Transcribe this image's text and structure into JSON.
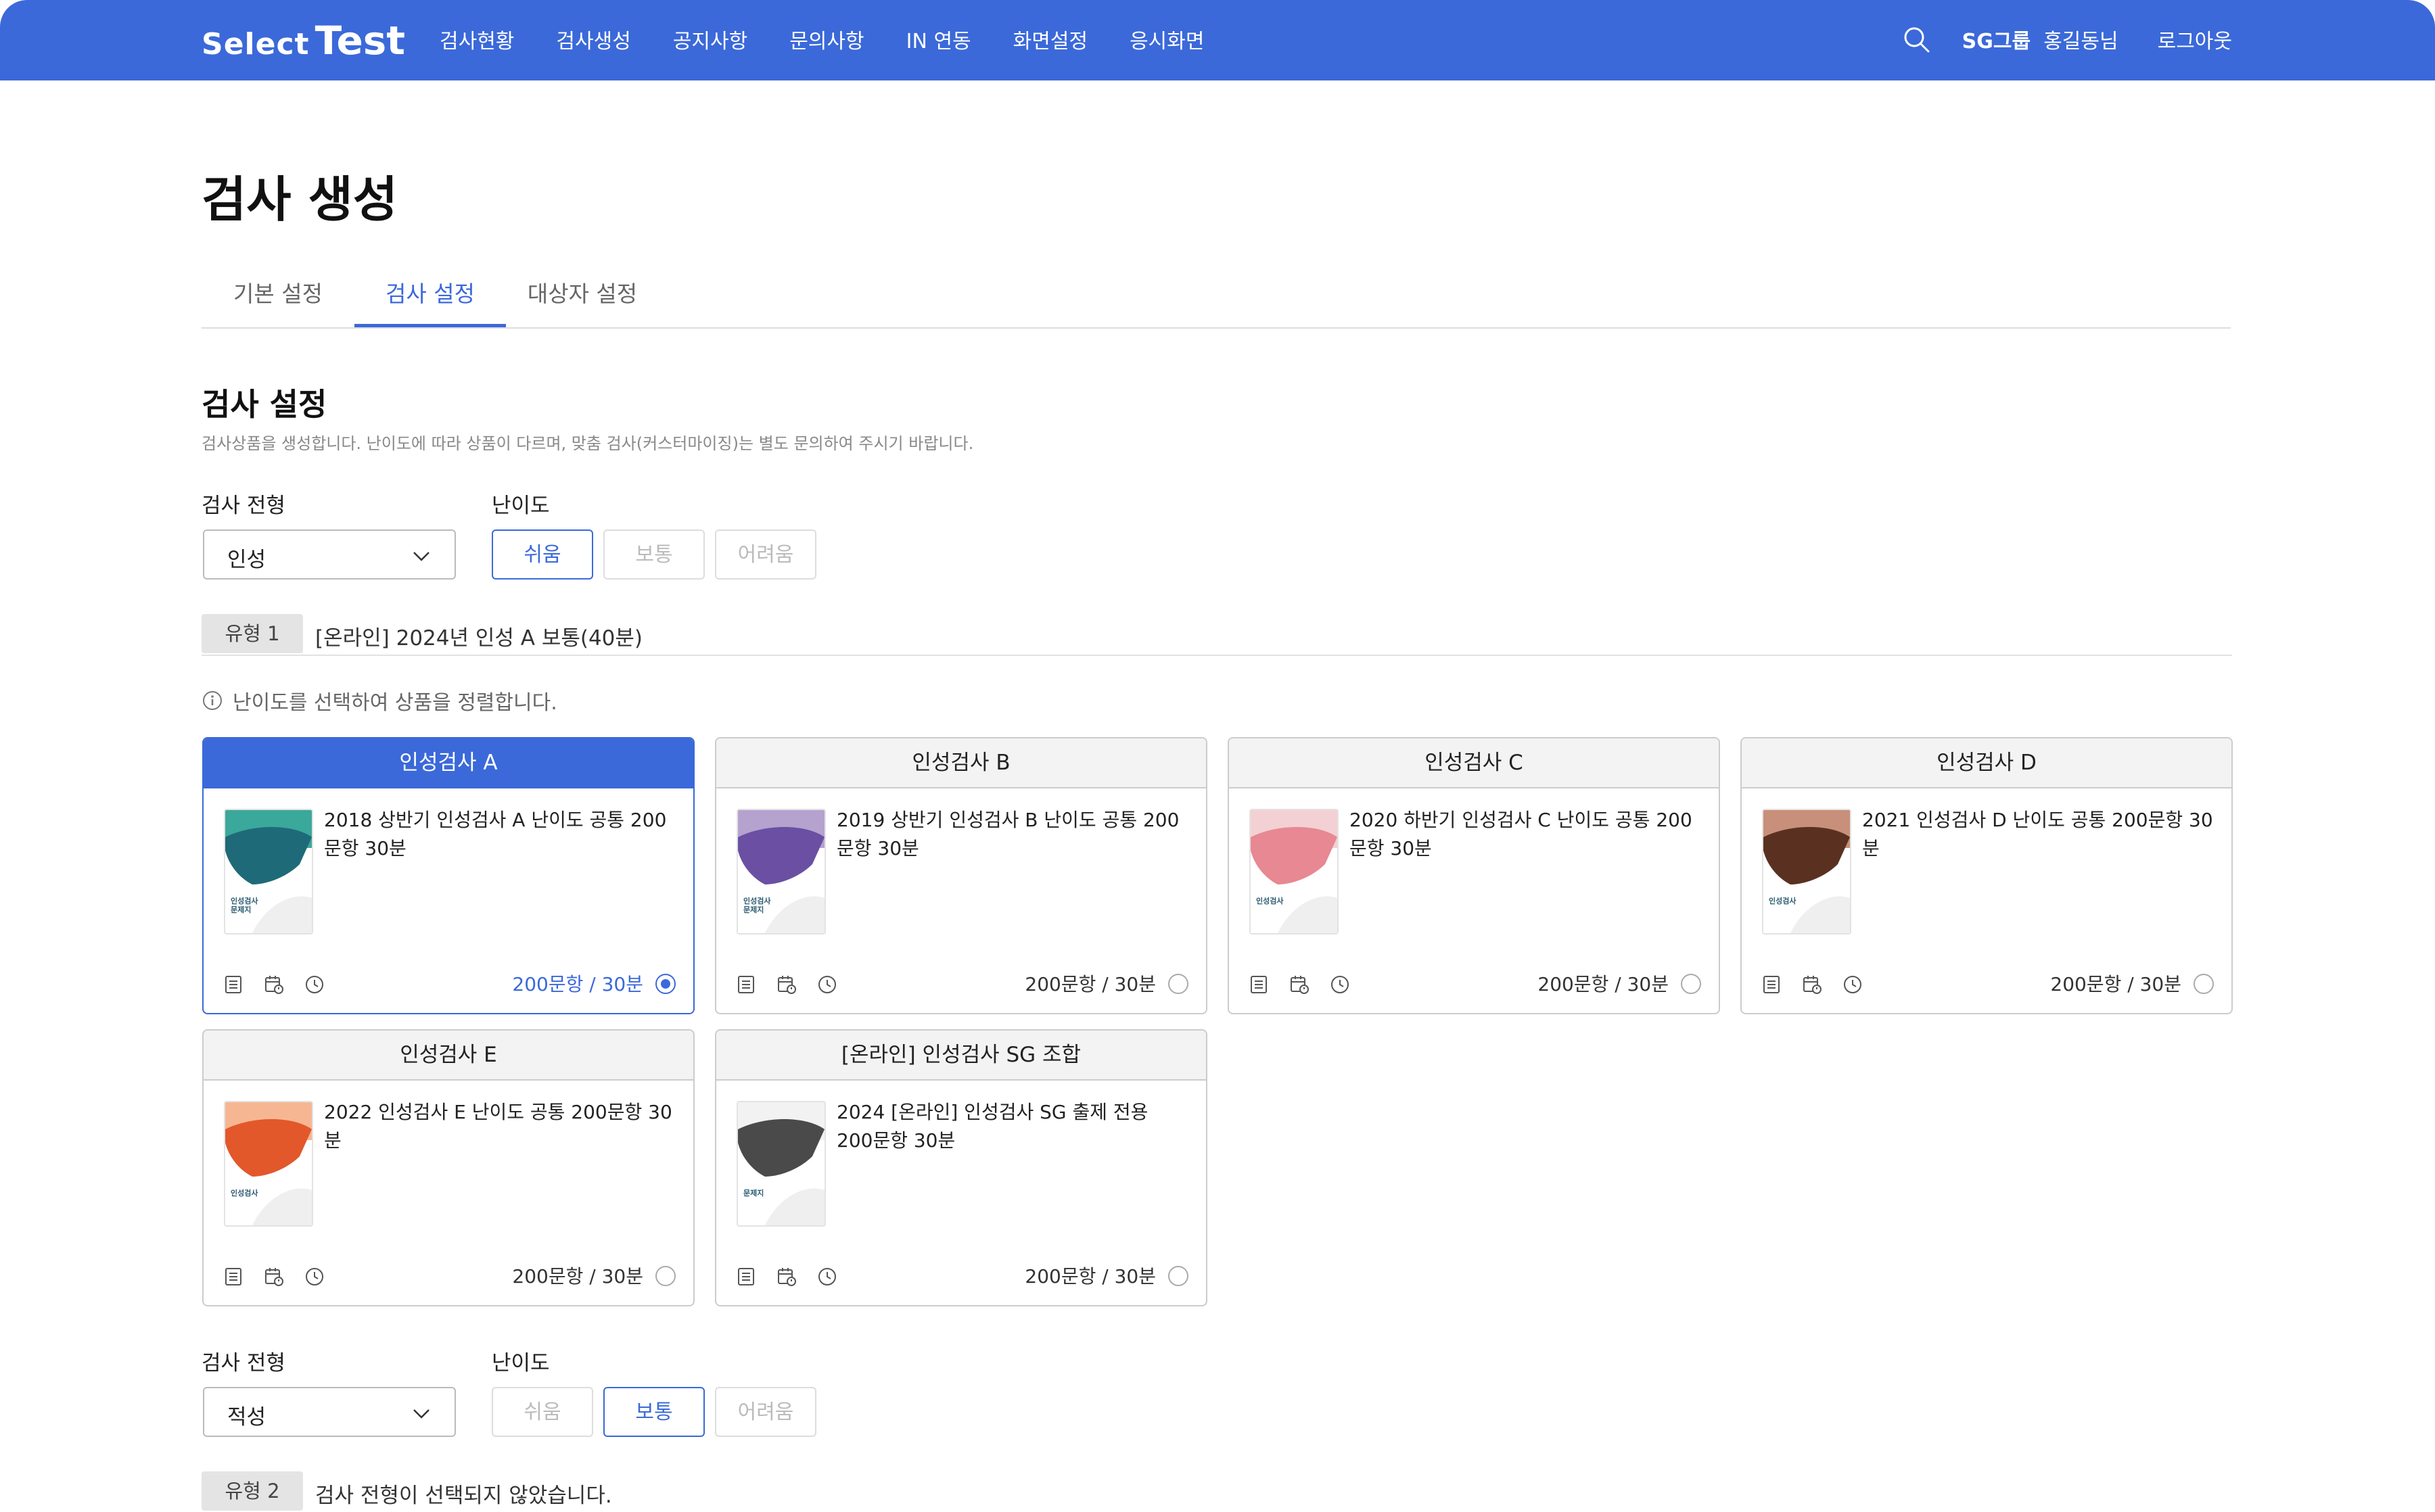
{
  "header": {
    "logo_part1": "Select",
    "logo_part2": "Test",
    "nav": [
      "검사현황",
      "검사생성",
      "공지사항",
      "문의사항",
      "IN 연동",
      "화면설정",
      "응시화면"
    ],
    "user_group": "SG그룹",
    "user_name": "홍길동님",
    "logout": "로그아웃",
    "search_icon": "search-icon"
  },
  "page": {
    "title": "검사 생성",
    "tabs": [
      {
        "label": "기본 설정",
        "active": false
      },
      {
        "label": "검사 설정",
        "active": true
      },
      {
        "label": "대상자 설정",
        "active": false
      }
    ]
  },
  "section": {
    "title": "검사 설정",
    "description": "검사상품을 생성합니다. 난이도에 따라 상품이 다르며, 맞춤 검사(커스터마이징)는 별도 문의하여 주시기 바랍니다."
  },
  "labels": {
    "exam_type": "검사 전형",
    "difficulty": "난이도"
  },
  "difficulty_options": [
    "쉬움",
    "보통",
    "어려움"
  ],
  "block1": {
    "type_value": "인성",
    "selected_difficulty": "쉬움",
    "type_badge": "유형 1",
    "type_text": "[온라인] 2024년 인성 A 보통(40분)",
    "info_text": "난이도를 선택하여 상품을 정렬합니다.",
    "cards": [
      {
        "title": "인성검사 A",
        "description": "2018 상반기 인성검사 A 난이도 공통 200문항 30분",
        "meta": "200문항 / 30분",
        "selected": true,
        "cover_top": "#3aa89a",
        "cover_shape": "#1f6a78",
        "cover_label": "인성검사\n문제지"
      },
      {
        "title": "인성검사 B",
        "description": "2019 상반기 인성검사 B 난이도 공통 200문항 30분",
        "meta": "200문항 / 30분",
        "selected": false,
        "cover_top": "#b5a2cf",
        "cover_shape": "#6b4fa3",
        "cover_label": "인성검사\n문제지"
      },
      {
        "title": "인성검사 C",
        "description": "2020 하반기 인성검사 C 난이도 공통 200문항 30분",
        "meta": "200문항 / 30분",
        "selected": false,
        "cover_top": "#f3d0d3",
        "cover_shape": "#e78892",
        "cover_label": "인성검사"
      },
      {
        "title": "인성검사 D",
        "description": "2021 인성검사 D 난이도 공통 200문항 30분",
        "meta": "200문항 / 30분",
        "selected": false,
        "cover_top": "#c8907a",
        "cover_shape": "#5a3120",
        "cover_label": "인성검사"
      },
      {
        "title": "인성검사 E",
        "description": "2022 인성검사 E 난이도 공통 200문항 30분",
        "meta": "200문항 / 30분",
        "selected": false,
        "cover_top": "#f6b692",
        "cover_shape": "#e2582b",
        "cover_label": "인성검사"
      },
      {
        "title": "[온라인] 인성검사 SG 조합",
        "description": "2024 [온라인] 인성검사 SG 출제 전용 200문항 30분",
        "meta": "200문항 / 30분",
        "selected": false,
        "cover_top": "#f2f2f2",
        "cover_shape": "#4a4a4a",
        "cover_label": "문제지"
      }
    ],
    "card_icons": [
      "document-icon",
      "calendar-lock-icon",
      "clock-icon"
    ]
  },
  "block2": {
    "type_value": "적성",
    "selected_difficulty": "보통",
    "type_badge": "유형 2",
    "type_text": "검사 전형이 선택되지 않았습니다."
  },
  "colors": {
    "primary": "#3b69d9"
  }
}
